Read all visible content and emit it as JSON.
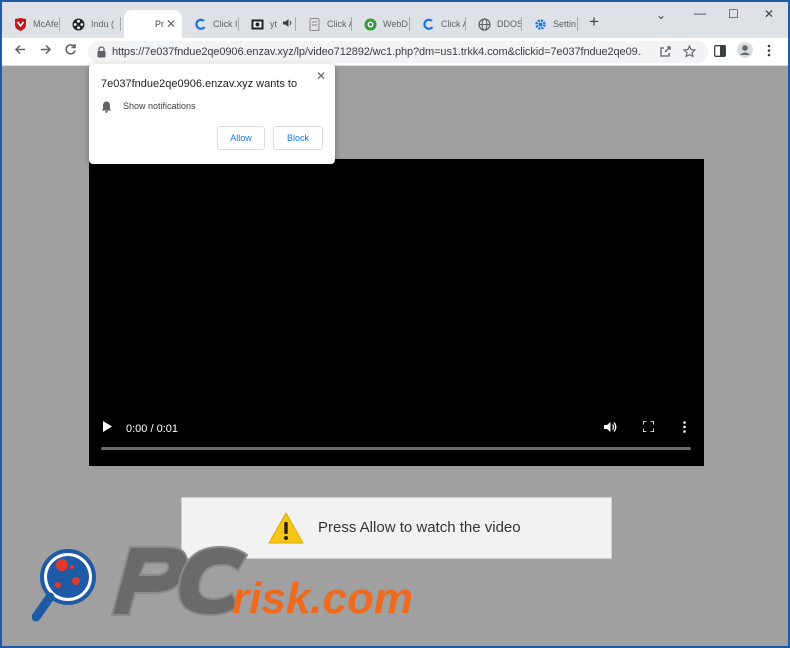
{
  "tabs": [
    {
      "label": "McAfe",
      "icon": "mcafee-shield-icon"
    },
    {
      "label": "Indu (",
      "icon": "film-reel-icon"
    },
    {
      "label": "Pr",
      "icon": "blank-page-icon",
      "active": true
    },
    {
      "label": "Click I",
      "icon": "blue-swirl-icon"
    },
    {
      "label": "yt",
      "icon": "video-thumb-icon"
    },
    {
      "label": "Click A",
      "icon": "grey-page-icon"
    },
    {
      "label": "WebD",
      "icon": "green-globe-icon"
    },
    {
      "label": "Click A",
      "icon": "blue-swirl-icon"
    },
    {
      "label": "DDOS",
      "icon": "globe-icon"
    },
    {
      "label": "Settin",
      "icon": "gear-icon"
    }
  ],
  "toolbar": {
    "url": "https://7e037fndue2qe0906.enzav.xyz/lp/video712892/wc1.php?dm=us1.trkk4.com&clickid=7e037fndue2qe09..."
  },
  "prompt": {
    "title": "7e037fndue2qe0906.enzav.xyz wants to",
    "permission": "Show notifications",
    "allow": "Allow",
    "block": "Block"
  },
  "video": {
    "time": "0:00 / 0:01",
    "progress": 0
  },
  "warning": {
    "text": "Press Allow to watch the video"
  },
  "colors": {
    "page_bg": "#a0a0a0",
    "accent": "#1a73e8",
    "watermark_orange": "#ee6a1f",
    "warning_yellow": "#f5c518"
  }
}
